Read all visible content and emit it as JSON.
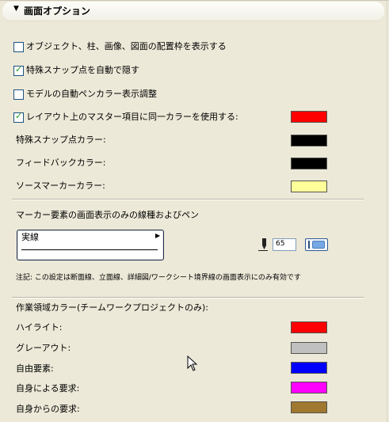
{
  "header": {
    "title": "画面オプション"
  },
  "options": [
    {
      "label": "オブジェクト、柱、画像、図面の配置枠を表示する",
      "checked": false
    },
    {
      "label": "特殊スナップ点を自動で隠す",
      "checked": true
    },
    {
      "label": "モデルの自動ペンカラー表示調整",
      "checked": false
    },
    {
      "label": "レイアウト上のマスター項目に同一カラーを使用する:",
      "checked": true,
      "color": "#ff0000"
    }
  ],
  "color_rows": [
    {
      "label": "特殊スナップ点カラー:",
      "color": "#000000"
    },
    {
      "label": "フィードバックカラー:",
      "color": "#000000"
    },
    {
      "label": "ソースマーカーカラー:",
      "color": "#ffff99"
    }
  ],
  "marker": {
    "title": "マーカー要素の画面表示のみの線種およびペン",
    "linetype": "実線",
    "pen_number": "65",
    "note": "注記: この設定は断面線、立面線、詳細図/ワークシート境界線の画面表示にのみ有効です"
  },
  "workspace": {
    "title": "作業領域カラー(チームワークプロジェクトのみ):",
    "rows": [
      {
        "label": "ハイライト:",
        "color": "#ff0000"
      },
      {
        "label": "グレーアウト:",
        "color": "#c0c0c0"
      },
      {
        "label": "自由要素:",
        "color": "#0000ff"
      },
      {
        "label": "自身による要求:",
        "color": "#ff00ff"
      },
      {
        "label": "自身からの要求:",
        "color": "#a07830"
      }
    ]
  },
  "icons": {
    "header_toggle": "triangle-down-icon",
    "pen": "pen-icon",
    "cursor": "mouse-pointer-icon",
    "linetype_popup": "triangle-right-icon"
  }
}
